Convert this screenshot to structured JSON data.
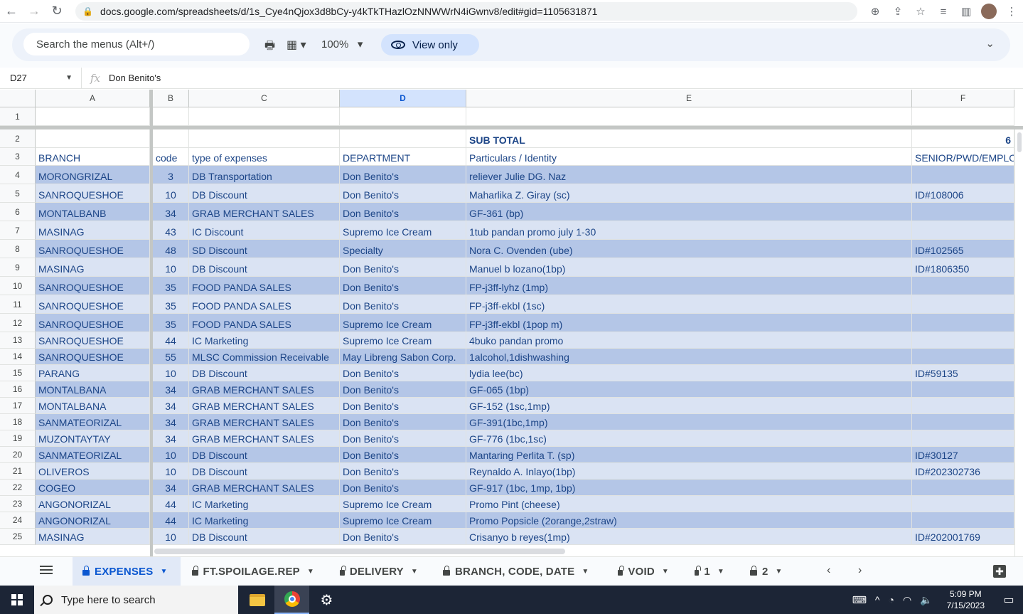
{
  "browser": {
    "url": "docs.google.com/spreadsheets/d/1s_Cye4nQjox3d8bCy-y4kTkTHazlOzNNWWrN4iGwnv8/edit#gid=1105631871"
  },
  "toolbar": {
    "search_placeholder": "Search the menus (Alt+/)",
    "zoom": "100%",
    "view_only": "View only"
  },
  "formula_bar": {
    "name_box": "D27",
    "fx": "fx",
    "value": "Don Benito's"
  },
  "columns": [
    "A",
    "B",
    "C",
    "D",
    "E",
    "F"
  ],
  "selected_column": "D",
  "row2": {
    "subtotal_label": "SUB TOTAL",
    "f_value": "6"
  },
  "header_row": {
    "a": "BRANCH",
    "b": "code",
    "c": "type of expenses",
    "d": "DEPARTMENT",
    "e": "Particulars / Identity",
    "f": "SENIOR/PWD/EMPLO"
  },
  "rows": [
    {
      "n": "4",
      "a": "MORONGRIZAL",
      "b": "3",
      "c": "DB Transportation",
      "d": "Don Benito's",
      "e": "reliever Julie DG. Naz",
      "f": ""
    },
    {
      "n": "5",
      "a": "SANROQUESHOE",
      "b": "10",
      "c": "DB Discount",
      "d": "Don Benito's",
      "e": "Maharlika Z. Giray (sc)",
      "f": "ID#108006"
    },
    {
      "n": "6",
      "a": "MONTALBANB",
      "b": "34",
      "c": "GRAB MERCHANT SALES",
      "d": "Don Benito's",
      "e": "GF-361 (bp)",
      "f": ""
    },
    {
      "n": "7",
      "a": "MASINAG",
      "b": "43",
      "c": "IC Discount",
      "d": "Supremo Ice Cream",
      "e": "1tub pandan promo july 1-30",
      "f": ""
    },
    {
      "n": "8",
      "a": "SANROQUESHOE",
      "b": "48",
      "c": "SD Discount",
      "d": "Specialty",
      "e": "Nora C. Ovenden (ube)",
      "f": "ID#102565"
    },
    {
      "n": "9",
      "a": "MASINAG",
      "b": "10",
      "c": "DB Discount",
      "d": "Don Benito's",
      "e": "Manuel b lozano(1bp)",
      "f": "ID#1806350"
    },
    {
      "n": "10",
      "a": "SANROQUESHOE",
      "b": "35",
      "c": "FOOD PANDA SALES",
      "d": "Don Benito's",
      "e": "FP-j3ff-lyhz (1mp)",
      "f": ""
    },
    {
      "n": "11",
      "a": "SANROQUESHOE",
      "b": "35",
      "c": "FOOD PANDA SALES",
      "d": "Don Benito's",
      "e": "FP-j3ff-ekbl (1sc)",
      "f": ""
    },
    {
      "n": "12",
      "a": "SANROQUESHOE",
      "b": "35",
      "c": "FOOD PANDA SALES",
      "d": "Supremo Ice Cream",
      "e": "FP-j3ff-ekbl (1pop m)",
      "f": ""
    },
    {
      "n": "13",
      "a": "SANROQUESHOE",
      "b": "44",
      "c": "IC Marketing",
      "d": "Supremo Ice Cream",
      "e": "4buko pandan promo",
      "f": ""
    },
    {
      "n": "14",
      "a": "SANROQUESHOE",
      "b": "55",
      "c": "MLSC Commission Receivable",
      "d": "May Libreng Sabon Corp.",
      "e": "1alcohol,1dishwashing",
      "f": ""
    },
    {
      "n": "15",
      "a": "PARANG",
      "b": "10",
      "c": "DB Discount",
      "d": "Don Benito's",
      "e": "lydia lee(bc)",
      "f": "ID#59135"
    },
    {
      "n": "16",
      "a": "MONTALBANA",
      "b": "34",
      "c": "GRAB MERCHANT SALES",
      "d": "Don Benito's",
      "e": "GF-065 (1bp)",
      "f": ""
    },
    {
      "n": "17",
      "a": "MONTALBANA",
      "b": "34",
      "c": "GRAB MERCHANT SALES",
      "d": "Don Benito's",
      "e": "GF-152 (1sc,1mp)",
      "f": ""
    },
    {
      "n": "18",
      "a": "SANMATEORIZAL",
      "b": "34",
      "c": "GRAB MERCHANT SALES",
      "d": "Don Benito's",
      "e": "GF-391(1bc,1mp)",
      "f": ""
    },
    {
      "n": "19",
      "a": "MUZONTAYTAY",
      "b": "34",
      "c": "GRAB MERCHANT SALES",
      "d": "Don Benito's",
      "e": "GF-776 (1bc,1sc)",
      "f": ""
    },
    {
      "n": "20",
      "a": "SANMATEORIZAL",
      "b": "10",
      "c": "DB Discount",
      "d": "Don Benito's",
      "e": "Mantaring Perlita T. (sp)",
      "f": "ID#30127"
    },
    {
      "n": "21",
      "a": "OLIVEROS",
      "b": "10",
      "c": "DB Discount",
      "d": "Don Benito's",
      "e": "Reynaldo A. Inlayo(1bp)",
      "f": "ID#202302736"
    },
    {
      "n": "22",
      "a": "COGEO",
      "b": "34",
      "c": "GRAB MERCHANT SALES",
      "d": "Don Benito's",
      "e": "GF-917 (1bc, 1mp, 1bp)",
      "f": ""
    },
    {
      "n": "23",
      "a": "ANGONORIZAL",
      "b": "44",
      "c": "IC Marketing",
      "d": "Supremo Ice Cream",
      "e": "Promo Pint (cheese)",
      "f": ""
    },
    {
      "n": "24",
      "a": "ANGONORIZAL",
      "b": "44",
      "c": "IC Marketing",
      "d": "Supremo Ice Cream",
      "e": "Promo Popsicle (2orange,2straw)",
      "f": ""
    },
    {
      "n": "25",
      "a": "MASINAG",
      "b": "10",
      "c": "DB Discount",
      "d": "Don Benito's",
      "e": "Crisanyo b reyes(1mp)",
      "f": "ID#202001769"
    }
  ],
  "row_numbers_top": [
    "1",
    "2",
    "3"
  ],
  "sheet_tabs": [
    {
      "label": "EXPENSES",
      "active": true
    },
    {
      "label": "FT.SPOILAGE.REP",
      "active": false
    },
    {
      "label": "DELIVERY",
      "active": false
    },
    {
      "label": "BRANCH, CODE, DATE",
      "active": false
    },
    {
      "label": "VOID",
      "active": false
    },
    {
      "label": "1",
      "active": false
    },
    {
      "label": "2",
      "active": false
    }
  ],
  "taskbar": {
    "search_placeholder": "Type here to search",
    "time": "5:09 PM",
    "date": "7/15/2023"
  },
  "colors": {
    "band_dark": "#b4c6e7",
    "band_light": "#dae3f3",
    "text_blue": "#1c4587",
    "accent": "#0b57d0"
  }
}
